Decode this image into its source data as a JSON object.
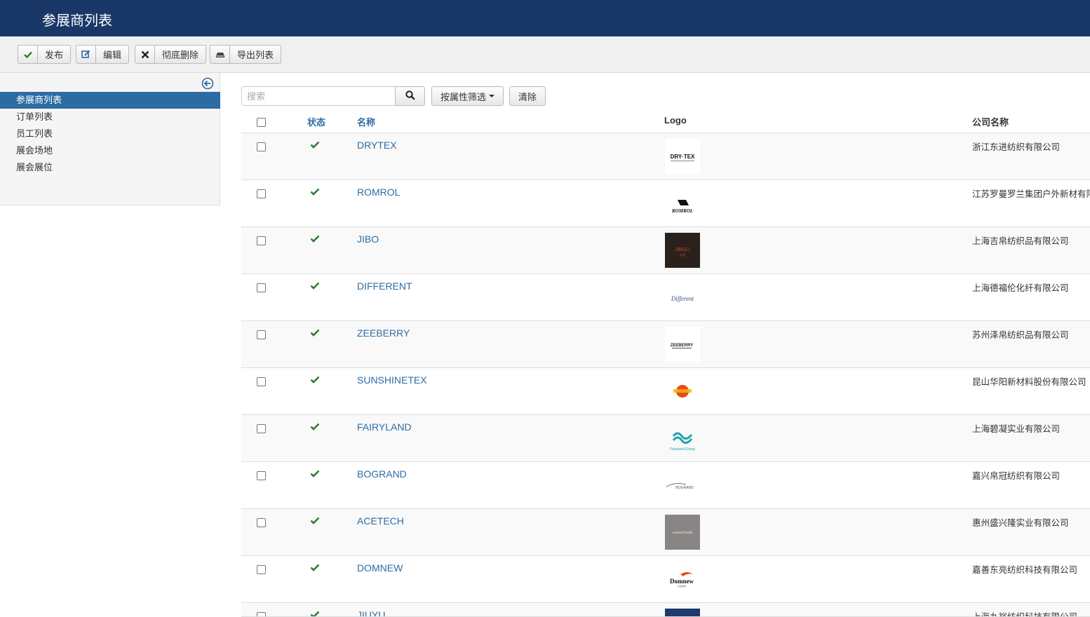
{
  "header": {
    "title": "参展商列表"
  },
  "toolbar": {
    "publish_label": "发布",
    "edit_label": "编辑",
    "delete_label": "彻底删除",
    "export_label": "导出列表"
  },
  "sidebar": {
    "items": [
      {
        "label": "参展商列表",
        "active": true
      },
      {
        "label": "订单列表"
      },
      {
        "label": "员工列表"
      },
      {
        "label": "展会场地"
      },
      {
        "label": "展会展位"
      }
    ]
  },
  "search": {
    "placeholder": "搜索",
    "filter_label": "按属性筛选",
    "clear_label": "清除"
  },
  "table": {
    "columns": {
      "status": "状态",
      "name": "名称",
      "logo": "Logo",
      "company": "公司名称"
    },
    "rows": [
      {
        "name": "DRYTEX",
        "company": "浙江东进纺织有限公司",
        "logo_text": "DRY·TEX",
        "status": "published"
      },
      {
        "name": "ROMROL",
        "company": "江苏罗曼罗兰集团户外新材有限",
        "logo_text": "ROMROL",
        "status": "published"
      },
      {
        "name": "JIBO",
        "company": "上海吉帛纺织品有限公司",
        "logo_text": "JIBOLI",
        "status": "published"
      },
      {
        "name": "DIFFERENT",
        "company": "上海德福伦化纤有限公司",
        "logo_text": "Different",
        "status": "published"
      },
      {
        "name": "ZEEBERRY",
        "company": "苏州泽帛纺织品有限公司",
        "logo_text": "ZEEBERRY",
        "status": "published"
      },
      {
        "name": "SUNSHINETEX",
        "company": "昆山华阳新材料股份有限公司",
        "logo_text": "",
        "status": "published"
      },
      {
        "name": "FAIRYLAND",
        "company": "上海碧凝实业有限公司",
        "logo_text": "Fairyland Group",
        "status": "published"
      },
      {
        "name": "BOGRAND",
        "company": "嘉兴帛冠纺织有限公司",
        "logo_text": "BOGRAND",
        "status": "published"
      },
      {
        "name": "ACETECH",
        "company": "惠州盛兴隆实业有限公司",
        "logo_text": "AcetechTextile",
        "status": "published"
      },
      {
        "name": "DOMNEW",
        "company": "嘉善东亮纺织科技有限公司",
        "logo_text": "Domnew",
        "status": "published"
      },
      {
        "name": "JIUYU",
        "company": "上海九裕纺织科技有限公司",
        "logo_text": "",
        "status": "published"
      }
    ]
  },
  "colors": {
    "header_bg": "#1a3867",
    "link": "#2d6ca2",
    "check": "#2e7d32",
    "active_sidebar": "#2d6ca2"
  }
}
